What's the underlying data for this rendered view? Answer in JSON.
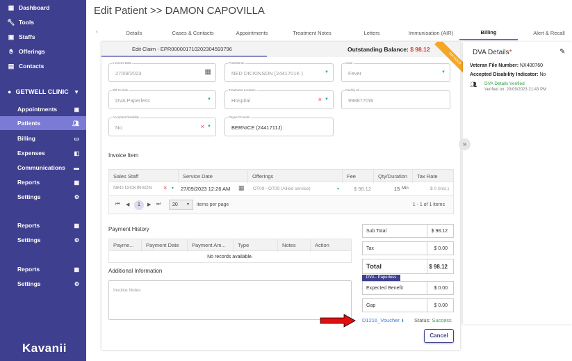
{
  "sidebar": {
    "top_items": [
      {
        "label": "Dashboard",
        "icon": "dashboard-icon"
      },
      {
        "label": "Tools",
        "icon": "wrench-icon"
      },
      {
        "label": "Staffs",
        "icon": "id-card-icon"
      },
      {
        "label": "Offerings",
        "icon": "hand-offering-icon"
      },
      {
        "label": "Contacts",
        "icon": "contacts-icon"
      }
    ],
    "clinic_name": "GETWELL CLINIC",
    "clinic_items": [
      {
        "label": "Appointments",
        "icon": "calendar-icon"
      },
      {
        "label": "Patients",
        "icon": "people-icon"
      },
      {
        "label": "Billing",
        "icon": "card-icon"
      },
      {
        "label": "Expenses",
        "icon": "expense-icon"
      },
      {
        "label": "Communications",
        "icon": "message-icon"
      },
      {
        "label": "Reports",
        "icon": "report-icon"
      },
      {
        "label": "Settings",
        "icon": "gear-icon"
      }
    ],
    "group2": [
      {
        "label": "Reports",
        "icon": "report-icon"
      },
      {
        "label": "Settings",
        "icon": "gear-icon"
      }
    ],
    "group3": [
      {
        "label": "Reports",
        "icon": "report-icon"
      },
      {
        "label": "Settings",
        "icon": "gear-icon"
      }
    ],
    "logo": "Kavanii"
  },
  "header": {
    "title": "Edit Patient >> DAMON CAPOVILLA"
  },
  "tabs": [
    "Details",
    "Cases & Contacts",
    "Appointments",
    "Treatment Notes",
    "Letters",
    "Immunisation (AIR)",
    "Billing",
    "Alert & Recall"
  ],
  "claim": {
    "label": "Edit Claim - EPR000001710202304593796",
    "outstanding_label": "Outstanding Balance:",
    "outstanding_amount": "$ 98.12",
    "ribbon": "ON HOLD"
  },
  "form": {
    "invoice_date": {
      "label": "Invoices Date",
      "value": "27/09/2023"
    },
    "practitioner": {
      "label": "Practitioner",
      "value": "NED DICKINSON (2441701K )"
    },
    "case": {
      "label": "Case",
      "value": "Fever"
    },
    "bill_to": {
      "label": "Bill To Disk",
      "value": "DVA Paperless"
    },
    "treatment_location": {
      "label": "Treatment Location",
      "value": "Hospital"
    },
    "facility_id": {
      "label": "Facility Id",
      "value": "9988770W"
    },
    "accepted_disability": {
      "label": "Accepted Disability",
      "value": "No"
    },
    "payee_provider": {
      "label": "Payee Provider",
      "value": "BERNICE  (2441711J)"
    }
  },
  "invoice_item": {
    "title": "Invoice Item",
    "headers": [
      "Sales Staff",
      "Service Date",
      "Offerings",
      "Fee",
      "Qty/Duration",
      "Tax Rate"
    ],
    "row": {
      "staff": "NED DICKINSON",
      "date": "27/09/2023 12:26 AM",
      "offering": "OT09 - OT09 (Allied service)",
      "fee": "$ 98.12",
      "qty": "15",
      "qty_unit": "Min",
      "tax": "$ 0 (Incl.)"
    },
    "pager": {
      "page": "1",
      "page_size": "20",
      "per_page_label": "items per page",
      "range": "1 - 1 of 1 items"
    }
  },
  "payment_history": {
    "title": "Payment History",
    "headers": [
      "Payme...",
      "Payment Date",
      "Payment Am...",
      "Type",
      "Notes",
      "Action"
    ],
    "empty": "No records available."
  },
  "additional": {
    "title": "Additional Information",
    "placeholder": "Invoice Notes"
  },
  "summary": {
    "subtotal_label": "Sub Total",
    "subtotal": "$ 98.12",
    "tax_label": "Tax",
    "tax": "$ 0.00",
    "total_label": "Total",
    "total": "$ 98.12",
    "dva_badge": "DVA - Paperless",
    "expected_label": "Expected Benefit",
    "expected": "$ 0.00",
    "gap_label": "Gap",
    "gap": "$ 0.00",
    "voucher": "D1216_Voucher",
    "status_label": "Status:",
    "status": "Success"
  },
  "cancel_label": "Cancel",
  "dva": {
    "title": "DVA Details",
    "asterisk": "*",
    "vet_label": "Veteran File Number:",
    "vet_value": "NX400760",
    "accepted_label": "Accepted Disability Indicator:",
    "accepted_value": "No",
    "verified": "DVA Details Verified",
    "verified_on": "Verified on: 20/09/2023 21:43 PM"
  },
  "colors": {
    "sidebar": "#3f3f8f",
    "active": "#7b7bd6",
    "danger": "#d9362b",
    "success": "#2e9e44",
    "ribbon": "#f5a623",
    "arrow": "#e01010"
  }
}
